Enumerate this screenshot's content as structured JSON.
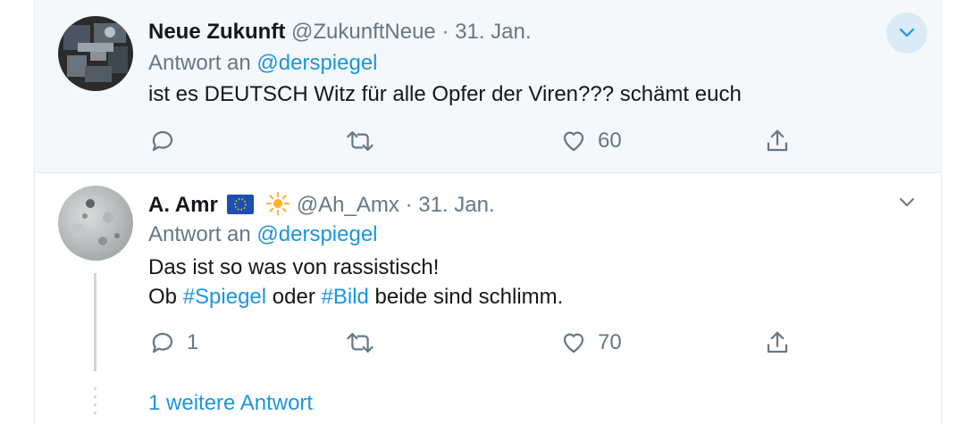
{
  "tweets": [
    {
      "name": "Neue Zukunft",
      "handle": "@ZukunftNeue",
      "date": "31. Jan.",
      "replying_label": "Antwort an",
      "replying_to": "@derspiegel",
      "text_line1": "ist es DEUTSCH Witz für alle Opfer der Viren??? schämt euch",
      "reply_count": "",
      "retweet_count": "",
      "like_count": "60"
    },
    {
      "name": "A. Amr",
      "flag_emoji": "🇪🇺",
      "sun_emoji": "🔆",
      "handle": "@Ah_Amx",
      "date": "31. Jan.",
      "replying_label": "Antwort an",
      "replying_to": "@derspiegel",
      "text_line1": "Das ist so was von  rassistisch!",
      "text_line2_prefix": "Ob",
      "hashtag1": "#Spiegel",
      "text_line2_mid": "oder",
      "hashtag2": "#Bild",
      "text_line2_suffix": "beide sind schlimm.",
      "reply_count": "1",
      "retweet_count": "",
      "like_count": "70"
    }
  ],
  "show_more_replies": "1 weitere Antwort",
  "icons": [
    "reply-icon",
    "retweet-icon",
    "like-icon",
    "share-icon",
    "caret-down-icon"
  ],
  "colors": {
    "link": "#1b95e0",
    "muted": "#657786",
    "hover_bg": "#f5f8fa"
  }
}
